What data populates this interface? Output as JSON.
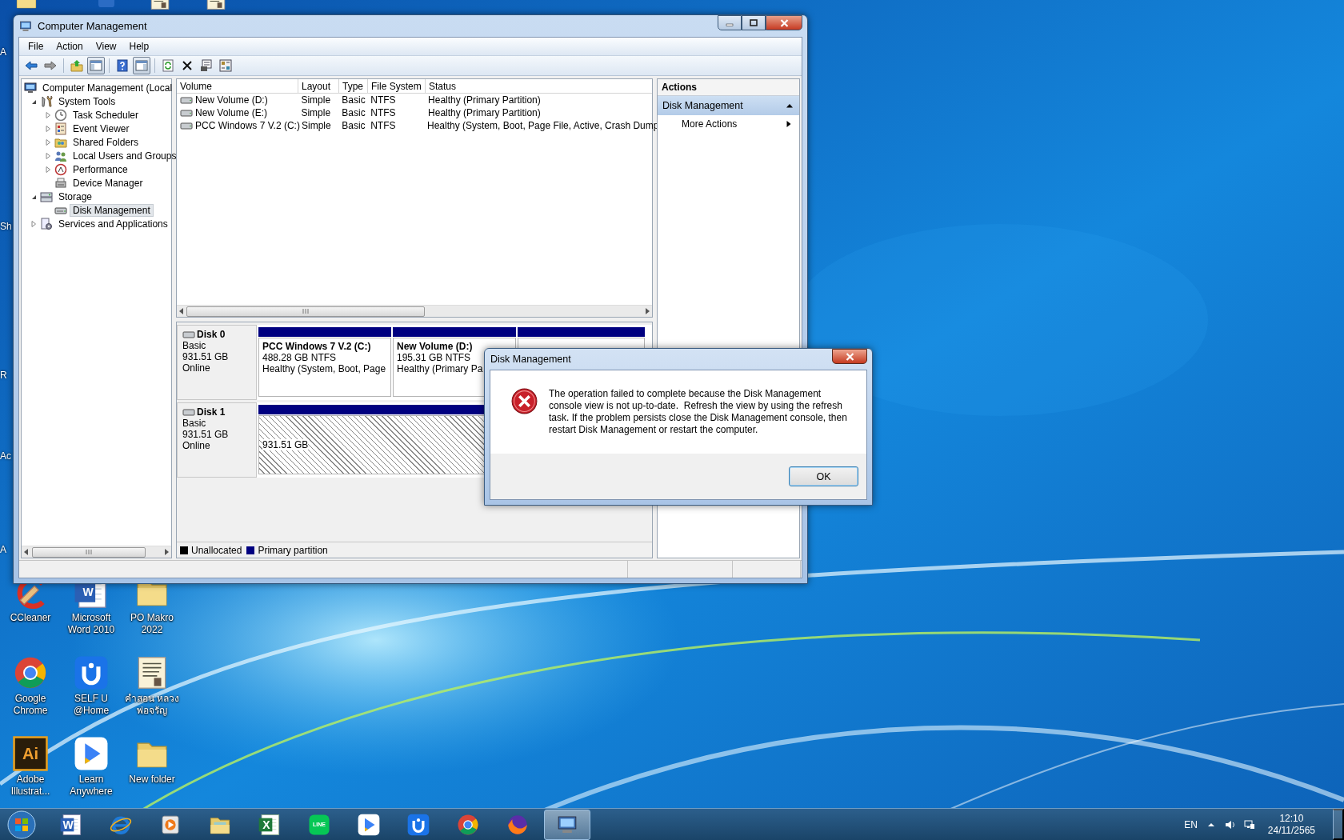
{
  "desktop": {
    "edge_labels": [
      "A",
      "Sh",
      "R",
      "Ac",
      "A"
    ],
    "top_icons": [
      {
        "kind": "folder"
      },
      {
        "kind": "app"
      },
      {
        "kind": "document"
      },
      {
        "kind": "document"
      }
    ],
    "icons": [
      {
        "label": "CCleaner",
        "kind": "ccleaner"
      },
      {
        "label": "Microsoft Word 2010",
        "kind": "word",
        "glyph": "W"
      },
      {
        "label": "PO Makro 2022",
        "kind": "folder"
      },
      {
        "label": "Google Chrome",
        "kind": "chrome"
      },
      {
        "label": "SELF U @Home",
        "kind": "selfu"
      },
      {
        "label": "คำสอน หลวงพ่อจรัญ",
        "kind": "document"
      },
      {
        "label": "Adobe Illustrat...",
        "kind": "illustrator",
        "glyph": "Ai"
      },
      {
        "label": "Learn Anywhere",
        "kind": "learn"
      },
      {
        "label": "New folder",
        "kind": "folder"
      }
    ]
  },
  "window": {
    "title": "Computer Management",
    "menu": [
      "File",
      "Action",
      "View",
      "Help"
    ],
    "toolbar": [
      {
        "kind": "back",
        "pressed": false
      },
      {
        "kind": "forward",
        "pressed": false
      },
      {
        "kind": "up",
        "pressed": false
      },
      {
        "kind": "tree-pane",
        "pressed": true
      },
      {
        "kind": "help",
        "pressed": false
      },
      {
        "kind": "action-pane",
        "pressed": true
      },
      {
        "kind": "refresh",
        "pressed": false
      },
      {
        "kind": "delete",
        "pressed": false
      },
      {
        "kind": "properties",
        "pressed": false
      },
      {
        "kind": "settings",
        "pressed": false
      }
    ],
    "tree": [
      {
        "label": "Computer Management (Local",
        "kind": "computer",
        "selected": false,
        "children": [
          {
            "label": "System Tools",
            "kind": "tools",
            "expanded": true,
            "selected": false,
            "children": [
              {
                "label": "Task Scheduler",
                "kind": "clock",
                "expanded": false,
                "selected": false
              },
              {
                "label": "Event Viewer",
                "kind": "event",
                "expanded": false,
                "selected": false
              },
              {
                "label": "Shared Folders",
                "kind": "shared",
                "expanded": false,
                "selected": false
              },
              {
                "label": "Local Users and Groups",
                "kind": "users",
                "expanded": false,
                "selected": false
              },
              {
                "label": "Performance",
                "kind": "performance",
                "expanded": false,
                "selected": false
              },
              {
                "label": "Device Manager",
                "kind": "device",
                "selected": false
              }
            ]
          },
          {
            "label": "Storage",
            "kind": "storage",
            "expanded": true,
            "selected": false,
            "children": [
              {
                "label": "Disk Management",
                "kind": "disk",
                "selected": true
              }
            ]
          },
          {
            "label": "Services and Applications",
            "kind": "services",
            "expanded": false,
            "selected": false
          }
        ]
      }
    ],
    "list": {
      "columns": [
        "Volume",
        "Layout",
        "Type",
        "File System",
        "Status"
      ],
      "rows": [
        {
          "cells": [
            "New Volume (D:)",
            "Simple",
            "Basic",
            "NTFS",
            "Healthy (Primary Partition)"
          ]
        },
        {
          "cells": [
            "New Volume (E:)",
            "Simple",
            "Basic",
            "NTFS",
            "Healthy (Primary Partition)"
          ]
        },
        {
          "cells": [
            "PCC Windows 7 V.2  (C:)",
            "Simple",
            "Basic",
            "NTFS",
            "Healthy (System, Boot, Page File, Active, Crash Dump"
          ]
        }
      ]
    },
    "disks": [
      {
        "name": "Disk 0",
        "type": "Basic",
        "size": "931.51 GB",
        "status": "Online",
        "partitions": [
          {
            "kind": "primary",
            "name": "PCC Windows 7 V.2   (C:)",
            "size": "488.28 GB NTFS",
            "status": "Healthy (System, Boot, Page"
          },
          {
            "kind": "primary",
            "name": "New Volume  (D:)",
            "size": "195.31 GB NTFS",
            "status": "Healthy (Primary Pa"
          },
          {
            "kind": "primary"
          }
        ]
      },
      {
        "name": "Disk 1",
        "type": "Basic",
        "size": "931.51 GB",
        "status": "Online",
        "partitions": [
          {
            "kind": "unallocated",
            "size": "931.51 GB"
          }
        ]
      }
    ],
    "legend": [
      {
        "label": "Unallocated",
        "color": "#000000"
      },
      {
        "label": "Primary partition",
        "color": "#000080"
      }
    ],
    "actions": {
      "title": "Actions",
      "section": "Disk Management",
      "items": [
        "More Actions"
      ]
    }
  },
  "dialog": {
    "title": "Disk Management",
    "message": "The operation failed to complete because the Disk Management console view is not up-to-date.  Refresh the view by using the refresh task. If the problem persists close the Disk Management console, then restart Disk Management or restart the computer.",
    "button": "OK"
  },
  "taskbar": {
    "items": [
      {
        "kind": "word",
        "glyph": "W",
        "selected": false
      },
      {
        "kind": "ie",
        "selected": false
      },
      {
        "kind": "media",
        "selected": false
      },
      {
        "kind": "explorer",
        "selected": false
      },
      {
        "kind": "excel",
        "glyph": "X",
        "selected": false
      },
      {
        "kind": "line",
        "glyph": "LINE",
        "selected": false
      },
      {
        "kind": "learn",
        "selected": false
      },
      {
        "kind": "selfu",
        "selected": false
      },
      {
        "kind": "chrome",
        "selected": false
      },
      {
        "kind": "firefox",
        "selected": false
      },
      {
        "kind": "computer",
        "selected": true
      }
    ],
    "language": "EN",
    "time": "12:10",
    "date": "24/11/2565"
  }
}
